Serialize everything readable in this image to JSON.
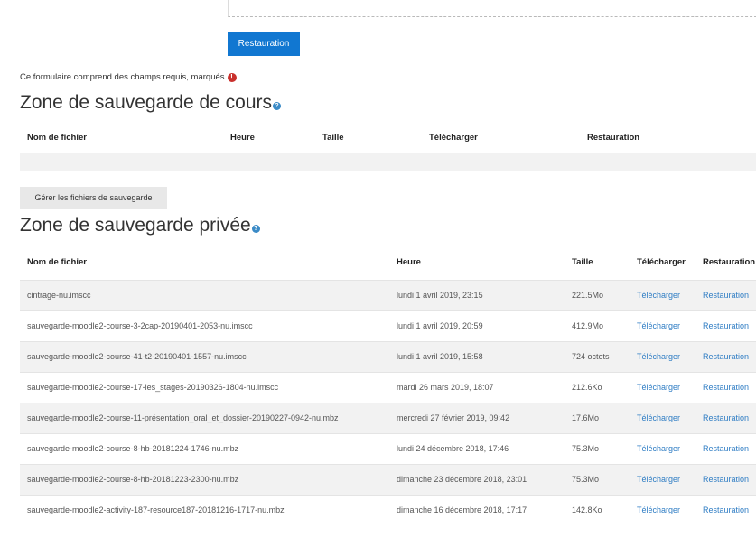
{
  "form": {
    "restore_button": "Restauration",
    "required_note": "Ce formulaire comprend des champs requis, marqués",
    "required_icon": "exclamation-icon",
    "required_suffix": "."
  },
  "course_backup": {
    "title": "Zone de sauvegarde de cours",
    "help_icon": "question-icon",
    "columns": [
      "Nom de fichier",
      "Heure",
      "Taille",
      "Télécharger",
      "Restauration"
    ]
  },
  "manage_button": "Gérer les fichiers de sauvegarde",
  "private_backup": {
    "title": "Zone de sauvegarde privée",
    "help_icon": "question-icon",
    "columns": [
      "Nom de fichier",
      "Heure",
      "Taille",
      "Télécharger",
      "Restauration"
    ],
    "rows": [
      {
        "name": "cintrage-nu.imscc",
        "time": "lundi 1 avril 2019, 23:15",
        "size": "221.5Mo",
        "download": "Télécharger",
        "restore": "Restauration"
      },
      {
        "name": "sauvegarde-moodle2-course-3-2cap-20190401-2053-nu.imscc",
        "time": "lundi 1 avril 2019, 20:59",
        "size": "412.9Mo",
        "download": "Télécharger",
        "restore": "Restauration"
      },
      {
        "name": "sauvegarde-moodle2-course-41-t2-20190401-1557-nu.imscc",
        "time": "lundi 1 avril 2019, 15:58",
        "size": "724 octets",
        "download": "Télécharger",
        "restore": "Restauration"
      },
      {
        "name": "sauvegarde-moodle2-course-17-les_stages-20190326-1804-nu.imscc",
        "time": "mardi 26 mars 2019, 18:07",
        "size": "212.6Ko",
        "download": "Télécharger",
        "restore": "Restauration"
      },
      {
        "name": "sauvegarde-moodle2-course-11-présentation_oral_et_dossier-20190227-0942-nu.mbz",
        "time": "mercredi 27 février 2019, 09:42",
        "size": "17.6Mo",
        "download": "Télécharger",
        "restore": "Restauration"
      },
      {
        "name": "sauvegarde-moodle2-course-8-hb-20181224-1746-nu.mbz",
        "time": "lundi 24 décembre 2018, 17:46",
        "size": "75.3Mo",
        "download": "Télécharger",
        "restore": "Restauration"
      },
      {
        "name": "sauvegarde-moodle2-course-8-hb-20181223-2300-nu.mbz",
        "time": "dimanche 23 décembre 2018, 23:01",
        "size": "75.3Mo",
        "download": "Télécharger",
        "restore": "Restauration"
      },
      {
        "name": "sauvegarde-moodle2-activity-187-resource187-20181216-1717-nu.mbz",
        "time": "dimanche 16 décembre 2018, 17:17",
        "size": "142.8Ko",
        "download": "Télécharger",
        "restore": "Restauration"
      }
    ]
  }
}
